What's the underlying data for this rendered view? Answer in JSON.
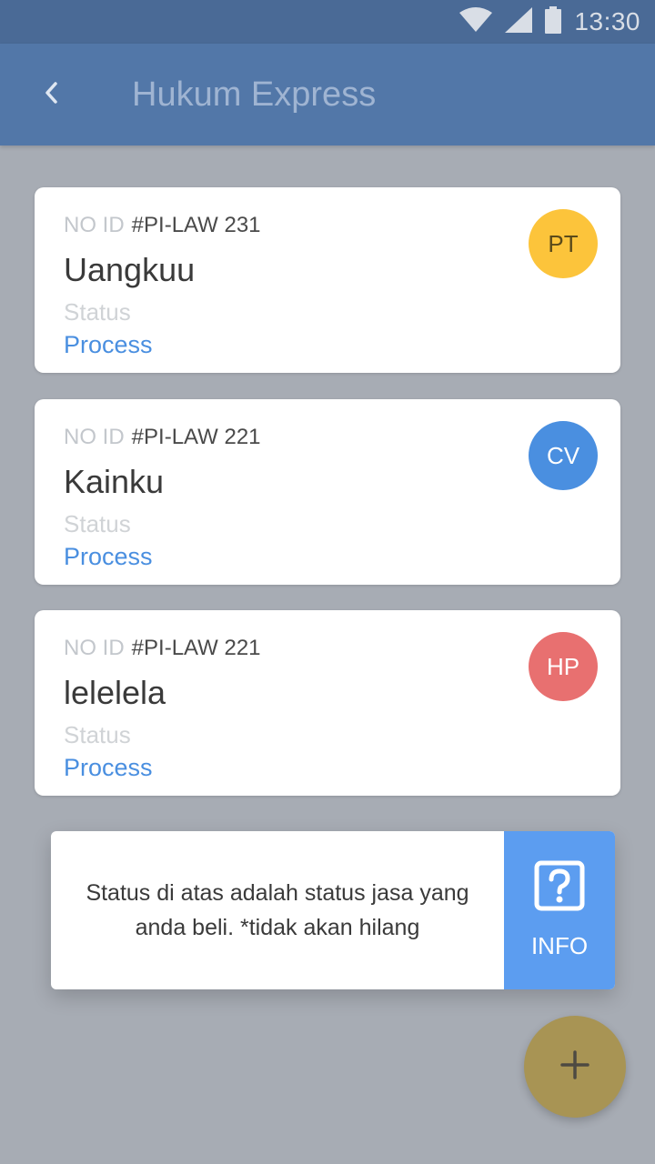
{
  "status_bar": {
    "time": "13:30",
    "icons": [
      "wifi-icon",
      "signal-icon",
      "battery-icon"
    ]
  },
  "app_bar": {
    "title": "Hukum Express",
    "back_icon": "chevron-left-icon"
  },
  "cards": [
    {
      "id_label": "NO ID",
      "id_value": "#PI-LAW 231",
      "name": "Uangkuu",
      "status_label": "Status",
      "status_value": "Process",
      "avatar_text": "PT",
      "avatar_color": "#fcc43b",
      "avatar_text_color": "#5a4a1a"
    },
    {
      "id_label": "NO ID",
      "id_value": "#PI-LAW 221",
      "name": "Kainku",
      "status_label": "Status",
      "status_value": "Process",
      "avatar_text": "CV",
      "avatar_color": "#4a8fe0",
      "avatar_text_color": "#ffffff"
    },
    {
      "id_label": "NO ID",
      "id_value": "#PI-LAW 221",
      "name": "lelelela",
      "status_label": "Status",
      "status_value": "Process",
      "avatar_text": "HP",
      "avatar_color": "#e87070",
      "avatar_text_color": "#ffffff"
    }
  ],
  "info_box": {
    "message": "Status di atas adalah status jasa yang anda beli. *tidak akan hilang",
    "button_label": "INFO",
    "button_icon": "question-box-icon"
  },
  "fab": {
    "icon": "plus-icon"
  },
  "colors": {
    "status_bar": "#4a6a96",
    "app_bar": "#5277a8",
    "background": "#a7acb4",
    "accent": "#4a8fe0",
    "info_button": "#5c9df0",
    "fab": "#a89454"
  }
}
